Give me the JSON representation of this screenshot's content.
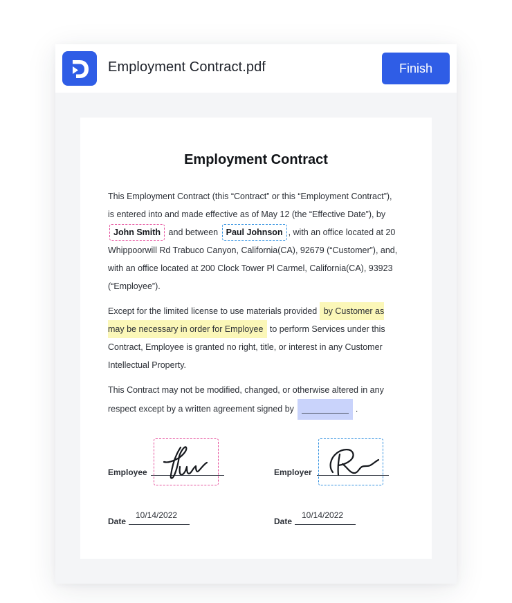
{
  "header": {
    "file_name": "Employment Contract.pdf",
    "finish_label": "Finish",
    "logo_icon": "docs-logo-icon",
    "brand_color": "#2f5de6"
  },
  "document": {
    "title": "Employment Contract",
    "paragraph1": {
      "before_party1": "This Employment Contract (this “Contract” or this “Employment Contract”), is entered into and made effective as of May 12 (the “Effective Date”), by",
      "party1": "John Smith",
      "between": "and between",
      "party2": "Paul Johnson",
      "after_party2": ", with an office located at 20 Whippoorwill Rd Trabuco Canyon, California(CA), 92679 (“Customer”), and, with an office located at 200 Clock Tower Pl Carmel, California(CA), 93923 (“Employee”)."
    },
    "paragraph2": {
      "before_highlight": "Except for the limited license to use materials provided",
      "highlight": "by Customer as may be necessary in order for Employee",
      "after_highlight": "to perform Services under this Contract, Employee is granted no right, title, or interest in any Customer Intellectual Property."
    },
    "paragraph3": {
      "text": "This Contract may not be modified, changed, or otherwise altered in any respect except by a written agreement signed by",
      "end": "."
    },
    "signatures": {
      "employee_label": "Employee",
      "employer_label": "Employer",
      "date_label": "Date",
      "employee_date": "10/14/2022",
      "employer_date": "10/14/2022"
    },
    "highlight_colors": {
      "party1_border": "#e54d9b",
      "party2_border": "#2e8fe0",
      "text_highlight": "#fbf7b8",
      "empty_field": "#c9d3fb"
    }
  }
}
